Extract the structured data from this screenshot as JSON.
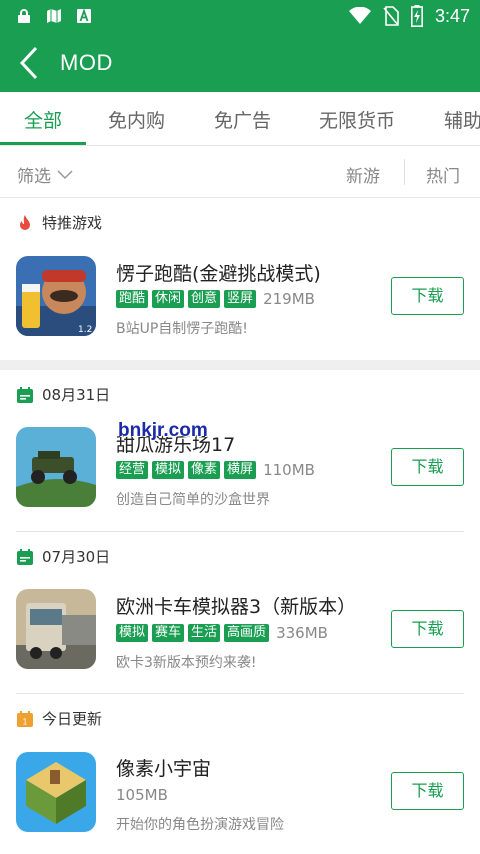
{
  "status_bar": {
    "time": "3:47",
    "icons_left": [
      "lock-icon",
      "map-icon",
      "font-icon"
    ],
    "icons_right": [
      "wifi-icon",
      "no-sim-icon",
      "battery-icon"
    ]
  },
  "app_bar": {
    "title": "MOD"
  },
  "tabs": [
    {
      "label": "全部",
      "active": true
    },
    {
      "label": "免内购",
      "active": false
    },
    {
      "label": "免广告",
      "active": false
    },
    {
      "label": "无限货币",
      "active": false
    },
    {
      "label": "辅助",
      "active": false
    }
  ],
  "filter_bar": {
    "filter_label": "筛选",
    "sort_new": "新游",
    "sort_hot": "热门"
  },
  "sections": [
    {
      "header": "特推游戏",
      "icon": "flame-icon",
      "app": {
        "name": "愣子跑酷(金避挑战模式)",
        "tags": [
          "跑酷",
          "休闲",
          "创意",
          "竖屏"
        ],
        "size": "219MB",
        "desc": "B站UP自制愣子跑酷!",
        "button": "下载"
      }
    },
    {
      "header": "08月31日",
      "icon": "calendar-icon",
      "app": {
        "name": "甜瓜游乐场17",
        "tags": [
          "经营",
          "模拟",
          "像素",
          "横屏"
        ],
        "size": "110MB",
        "desc": "创造自己简单的沙盒世界",
        "button": "下载"
      }
    },
    {
      "header": "07月30日",
      "icon": "calendar-icon",
      "app": {
        "name": "欧洲卡车模拟器3（新版本）",
        "tags": [
          "模拟",
          "赛车",
          "生活",
          "高画质"
        ],
        "size": "336MB",
        "desc": "欧卡3新版本预约来袭!",
        "button": "下载"
      }
    },
    {
      "header": "今日更新",
      "icon": "today-calendar-icon",
      "app": {
        "name": "像素小宇宙",
        "tags": [],
        "size": "105MB",
        "desc": "开始你的角色扮演游戏冒险",
        "button": "下载"
      }
    }
  ],
  "watermark": "bnkjr.com",
  "colors": {
    "primary": "#1a9e52",
    "today_icon": "#f0a030",
    "flame": "#e84a3c"
  }
}
